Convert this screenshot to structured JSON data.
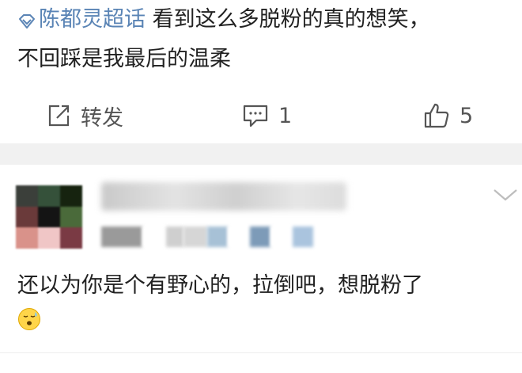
{
  "post": {
    "topic": "陈都灵超话",
    "text_line1": " 看到这么多脱粉的真的想笑，",
    "text_line2": "不回踩是我最后的温柔"
  },
  "actions": {
    "repost_label": "转发",
    "comment_count": "1",
    "like_count": "5"
  },
  "comment": {
    "text": "还以为你是个有野心的，拉倒吧，想脱粉了",
    "emoji": "sweat-smile-emoji"
  },
  "colors": {
    "topic": "#5a84b5",
    "divider": "#f1f1f1"
  }
}
